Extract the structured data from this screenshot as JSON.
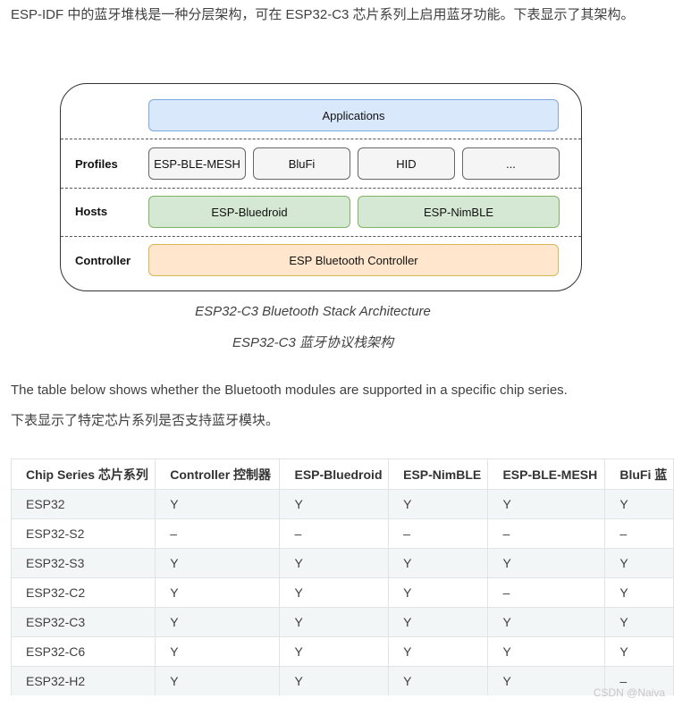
{
  "intro_text": "ESP-IDF 中的蓝牙堆栈是一种分层架构，可在 ESP32-C3 芯片系列上启用蓝牙功能。下表显示了其架构。",
  "diagram": {
    "applications": "Applications",
    "rows": {
      "profiles": "Profiles",
      "hosts": "Hosts",
      "controller": "Controller"
    },
    "profiles": [
      "ESP-BLE-MESH",
      "BluFi",
      "HID",
      "..."
    ],
    "hosts": [
      "ESP-Bluedroid",
      "ESP-NimBLE"
    ],
    "controller_box": "ESP Bluetooth Controller"
  },
  "caption_en": "ESP32-C3 Bluetooth Stack Architecture",
  "caption_zh": "ESP32-C3 蓝牙协议栈架构",
  "para_en": "The table below shows whether the Bluetooth modules are supported in a specific chip series.",
  "para_zh": "下表显示了特定芯片系列是否支持蓝牙模块。",
  "table": {
    "headers": [
      "Chip Series 芯片系列",
      "Controller 控制器",
      "ESP-Bluedroid",
      "ESP-NimBLE",
      "ESP-BLE-MESH",
      "BluFi 蓝"
    ],
    "rows": [
      [
        "ESP32",
        "Y",
        "Y",
        "Y",
        "Y",
        "Y"
      ],
      [
        "ESP32-S2",
        "–",
        "–",
        "–",
        "–",
        "–"
      ],
      [
        "ESP32-S3",
        "Y",
        "Y",
        "Y",
        "Y",
        "Y"
      ],
      [
        "ESP32-C2",
        "Y",
        "Y",
        "Y",
        "–",
        "Y"
      ],
      [
        "ESP32-C3",
        "Y",
        "Y",
        "Y",
        "Y",
        "Y"
      ],
      [
        "ESP32-C6",
        "Y",
        "Y",
        "Y",
        "Y",
        "Y"
      ],
      [
        "ESP32-H2",
        "Y",
        "Y",
        "Y",
        "Y",
        "–"
      ]
    ]
  },
  "watermark": "CSDN @Naiva"
}
